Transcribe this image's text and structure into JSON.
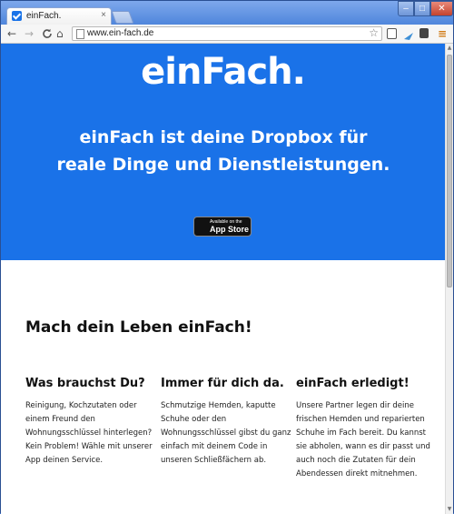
{
  "browser": {
    "tab_title": "einFach.",
    "tab_close": "×",
    "url": "www.ein-fach.de",
    "back": "←",
    "forward": "→",
    "reload": "C",
    "home": "⌂",
    "star": "☆",
    "menu": "≡",
    "minimize": "–",
    "maximize": "□",
    "close": "✕"
  },
  "hero": {
    "logo": "einFach.",
    "tagline": "einFach ist deine Dropbox für reale Dinge und Dienstleistungen.",
    "appstore_small": "Available on the",
    "appstore_big": "App Store",
    "background": "#1a72e8"
  },
  "section": {
    "headline": "Mach dein Leben einFach!",
    "columns": [
      {
        "title": "Was brauchst Du?",
        "text": "Reinigung, Kochzutaten oder einem Freund den Wohnungsschlüssel hinterlegen? Kein Problem! Wähle mit unserer App deinen Service."
      },
      {
        "title": "Immer für dich da.",
        "text": "Schmutzige Hemden, kaputte Schuhe oder den Wohnungsschlüssel gibst du ganz einfach mit deinem Code in unseren Schließfächern ab."
      },
      {
        "title": "einFach erledigt!",
        "text": "Unsere Partner legen dir deine frischen Hemden und reparierten Schuhe im Fach bereit. Du kannst sie abholen, wann es dir passt und auch noch die Zutaten für dein Abendessen direkt mitnehmen."
      }
    ]
  }
}
